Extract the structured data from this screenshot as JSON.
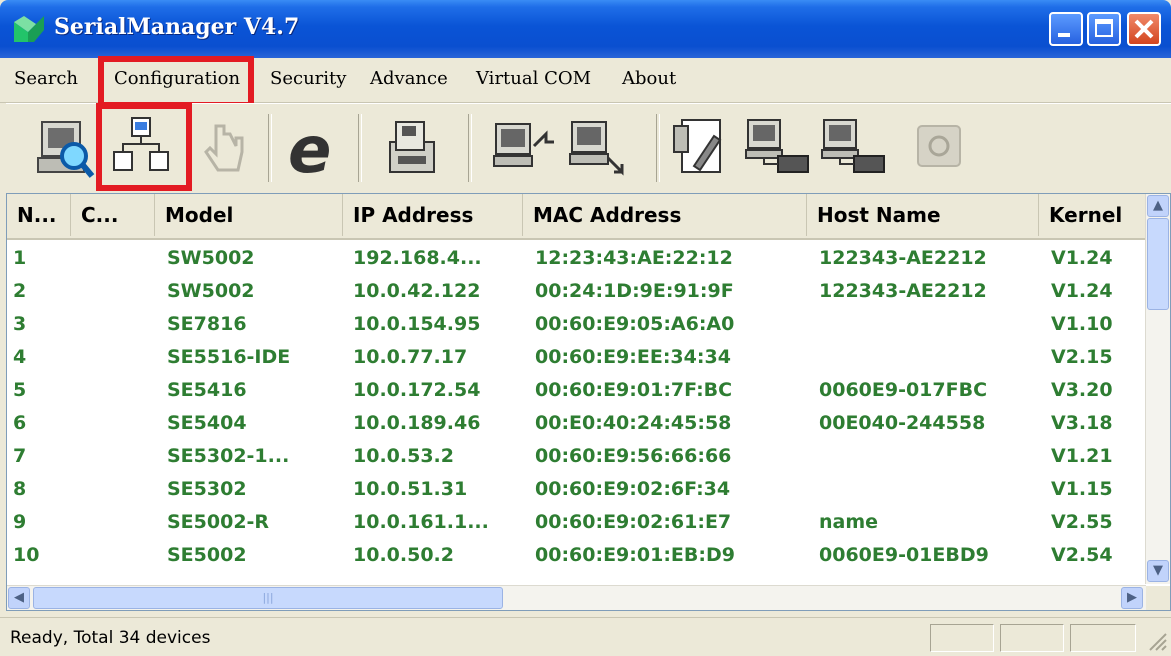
{
  "window": {
    "title": "SerialManager V4.7",
    "controls": {
      "minimize": "_",
      "maximize": "□",
      "close": "X"
    }
  },
  "menu": [
    {
      "label": "Search"
    },
    {
      "label": "Configuration"
    },
    {
      "label": "Security"
    },
    {
      "label": "Advance"
    },
    {
      "label": "Virtual COM"
    },
    {
      "label": "About"
    }
  ],
  "toolbar": {
    "buttons": [
      {
        "icon": "search-computer-icon",
        "enabled": true
      },
      {
        "icon": "network-configuration-icon",
        "enabled": true
      },
      {
        "icon": "hand-pointer-icon",
        "enabled": false
      },
      {
        "icon": "internet-explorer-icon",
        "enabled": true
      },
      {
        "icon": "save-to-disk-icon",
        "enabled": true
      },
      {
        "icon": "computer-outgoing-icon",
        "enabled": true
      },
      {
        "icon": "computer-incoming-icon",
        "enabled": true
      },
      {
        "icon": "edit-document-icon",
        "enabled": true
      },
      {
        "icon": "computer-serial-icon",
        "enabled": true
      },
      {
        "icon": "computer-serial-alt-icon",
        "enabled": true
      },
      {
        "icon": "telephone-icon",
        "enabled": false
      }
    ]
  },
  "table": {
    "columns": [
      "N...",
      "C...",
      "Model",
      "IP Address",
      "MAC Address",
      "Host Name",
      "Kernel"
    ],
    "rows": [
      {
        "no": "1",
        "c": "",
        "model": "SW5002",
        "ip": "192.168.4...",
        "mac": "12:23:43:AE:22:12",
        "host": "122343-AE2212",
        "kernel": "V1.24"
      },
      {
        "no": "2",
        "c": "",
        "model": "SW5002",
        "ip": "10.0.42.122",
        "mac": "00:24:1D:9E:91:9F",
        "host": "122343-AE2212",
        "kernel": "V1.24"
      },
      {
        "no": "3",
        "c": "",
        "model": "SE7816",
        "ip": "10.0.154.95",
        "mac": "00:60:E9:05:A6:A0",
        "host": "",
        "kernel": "V1.10"
      },
      {
        "no": "4",
        "c": "",
        "model": "SE5516-IDE",
        "ip": "10.0.77.17",
        "mac": "00:60:E9:EE:34:34",
        "host": "",
        "kernel": "V2.15"
      },
      {
        "no": "5",
        "c": "",
        "model": "SE5416",
        "ip": "10.0.172.54",
        "mac": "00:60:E9:01:7F:BC",
        "host": "0060E9-017FBC",
        "kernel": "V3.20"
      },
      {
        "no": "6",
        "c": "",
        "model": "SE5404",
        "ip": "10.0.189.46",
        "mac": "00:E0:40:24:45:58",
        "host": "00E040-244558",
        "kernel": "V3.18"
      },
      {
        "no": "7",
        "c": "",
        "model": "SE5302-1...",
        "ip": "10.0.53.2",
        "mac": "00:60:E9:56:66:66",
        "host": "",
        "kernel": "V1.21"
      },
      {
        "no": "8",
        "c": "",
        "model": "SE5302",
        "ip": "10.0.51.31",
        "mac": "00:60:E9:02:6F:34",
        "host": "",
        "kernel": "V1.15"
      },
      {
        "no": "9",
        "c": "",
        "model": "SE5002-R",
        "ip": "10.0.161.1...",
        "mac": "00:60:E9:02:61:E7",
        "host": "name",
        "kernel": "V2.55"
      },
      {
        "no": "10",
        "c": "",
        "model": "SE5002",
        "ip": "10.0.50.2",
        "mac": "00:60:E9:01:EB:D9",
        "host": "0060E9-01EBD9",
        "kernel": "V2.54"
      }
    ]
  },
  "status": {
    "text": "Ready, Total 34 devices"
  },
  "colors": {
    "row_text": "#2e7d32",
    "highlight": "#e31b23",
    "title_bar": "#0a54d6"
  }
}
